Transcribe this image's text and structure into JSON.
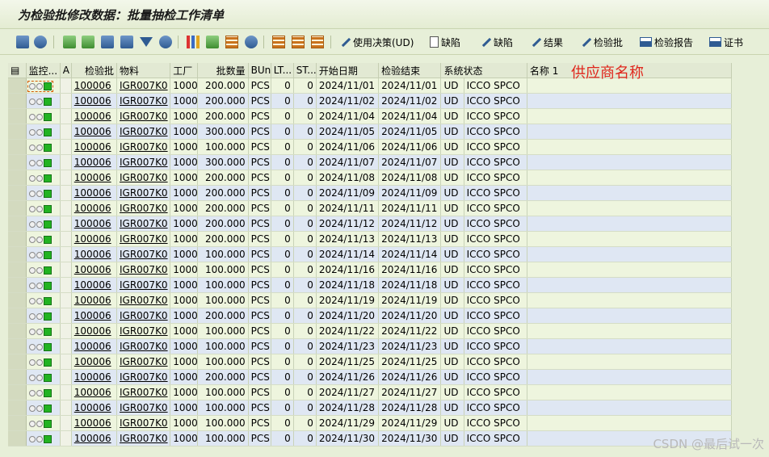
{
  "window": {
    "title": "为检验批修改数据：批量抽检工作清单"
  },
  "toolbar": {
    "use_decision_label": "使用决策(UD)",
    "defect_1_label": "缺陷",
    "defect_2_label": "缺陷",
    "result_label": "结果",
    "inspection_lot_label": "检验批",
    "inspection_report_label": "检验报告",
    "certificate_label": "证书"
  },
  "table": {
    "columns": [
      "监控...",
      "A",
      "检验批",
      "物料",
      "工厂",
      "批数量",
      "BUn",
      "LT...",
      "ST...",
      "开始日期",
      "检验结束",
      "系统状态",
      "",
      "名称 1"
    ],
    "rows": [
      [
        "100006",
        "IGR007K0",
        "1000",
        "200.000",
        "PCS",
        "0",
        "0",
        "2024/11/01",
        "2024/11/01",
        "UD",
        "ICCO SPCO"
      ],
      [
        "100006",
        "IGR007K0",
        "1000",
        "200.000",
        "PCS",
        "0",
        "0",
        "2024/11/02",
        "2024/11/02",
        "UD",
        "ICCO SPCO"
      ],
      [
        "100006",
        "IGR007K0",
        "1000",
        "200.000",
        "PCS",
        "0",
        "0",
        "2024/11/04",
        "2024/11/04",
        "UD",
        "ICCO SPCO"
      ],
      [
        "100006",
        "IGR007K0",
        "1000",
        "300.000",
        "PCS",
        "0",
        "0",
        "2024/11/05",
        "2024/11/05",
        "UD",
        "ICCO SPCO"
      ],
      [
        "100006",
        "IGR007K0",
        "1000",
        "100.000",
        "PCS",
        "0",
        "0",
        "2024/11/06",
        "2024/11/06",
        "UD",
        "ICCO SPCO"
      ],
      [
        "100006",
        "IGR007K0",
        "1000",
        "300.000",
        "PCS",
        "0",
        "0",
        "2024/11/07",
        "2024/11/07",
        "UD",
        "ICCO SPCO"
      ],
      [
        "100006",
        "IGR007K0",
        "1000",
        "200.000",
        "PCS",
        "0",
        "0",
        "2024/11/08",
        "2024/11/08",
        "UD",
        "ICCO SPCO"
      ],
      [
        "100006",
        "IGR007K0",
        "1000",
        "200.000",
        "PCS",
        "0",
        "0",
        "2024/11/09",
        "2024/11/09",
        "UD",
        "ICCO SPCO"
      ],
      [
        "100006",
        "IGR007K0",
        "1000",
        "200.000",
        "PCS",
        "0",
        "0",
        "2024/11/11",
        "2024/11/11",
        "UD",
        "ICCO SPCO"
      ],
      [
        "100006",
        "IGR007K0",
        "1000",
        "200.000",
        "PCS",
        "0",
        "0",
        "2024/11/12",
        "2024/11/12",
        "UD",
        "ICCO SPCO"
      ],
      [
        "100006",
        "IGR007K0",
        "1000",
        "200.000",
        "PCS",
        "0",
        "0",
        "2024/11/13",
        "2024/11/13",
        "UD",
        "ICCO SPCO"
      ],
      [
        "100006",
        "IGR007K0",
        "1000",
        "100.000",
        "PCS",
        "0",
        "0",
        "2024/11/14",
        "2024/11/14",
        "UD",
        "ICCO SPCO"
      ],
      [
        "100006",
        "IGR007K0",
        "1000",
        "100.000",
        "PCS",
        "0",
        "0",
        "2024/11/16",
        "2024/11/16",
        "UD",
        "ICCO SPCO"
      ],
      [
        "100006",
        "IGR007K0",
        "1000",
        "100.000",
        "PCS",
        "0",
        "0",
        "2024/11/18",
        "2024/11/18",
        "UD",
        "ICCO SPCO"
      ],
      [
        "100006",
        "IGR007K0",
        "1000",
        "100.000",
        "PCS",
        "0",
        "0",
        "2024/11/19",
        "2024/11/19",
        "UD",
        "ICCO SPCO"
      ],
      [
        "100006",
        "IGR007K0",
        "1000",
        "200.000",
        "PCS",
        "0",
        "0",
        "2024/11/20",
        "2024/11/20",
        "UD",
        "ICCO SPCO"
      ],
      [
        "100006",
        "IGR007K0",
        "1000",
        "100.000",
        "PCS",
        "0",
        "0",
        "2024/11/22",
        "2024/11/22",
        "UD",
        "ICCO SPCO"
      ],
      [
        "100006",
        "IGR007K0",
        "1000",
        "100.000",
        "PCS",
        "0",
        "0",
        "2024/11/23",
        "2024/11/23",
        "UD",
        "ICCO SPCO"
      ],
      [
        "100006",
        "IGR007K0",
        "1000",
        "100.000",
        "PCS",
        "0",
        "0",
        "2024/11/25",
        "2024/11/25",
        "UD",
        "ICCO SPCO"
      ],
      [
        "100006",
        "IGR007K0",
        "1000",
        "200.000",
        "PCS",
        "0",
        "0",
        "2024/11/26",
        "2024/11/26",
        "UD",
        "ICCO SPCO"
      ],
      [
        "100006",
        "IGR007K0",
        "1000",
        "100.000",
        "PCS",
        "0",
        "0",
        "2024/11/27",
        "2024/11/27",
        "UD",
        "ICCO SPCO"
      ],
      [
        "100006",
        "IGR007K0",
        "1000",
        "100.000",
        "PCS",
        "0",
        "0",
        "2024/11/28",
        "2024/11/28",
        "UD",
        "ICCO SPCO"
      ],
      [
        "100006",
        "IGR007K0",
        "1000",
        "100.000",
        "PCS",
        "0",
        "0",
        "2024/11/29",
        "2024/11/29",
        "UD",
        "ICCO SPCO"
      ],
      [
        "100006",
        "IGR007K0",
        "1000",
        "100.000",
        "PCS",
        "0",
        "0",
        "2024/11/30",
        "2024/11/30",
        "UD",
        "ICCO SPCO"
      ]
    ]
  },
  "annotation": {
    "vendor_name_label": "供应商名称"
  },
  "watermark": "CSDN @最后试一次",
  "colors": {
    "row_odd": "#eef5de",
    "row_even": "#dfe7f3",
    "annotation": "#e0261c",
    "status_lamp": "#22b322"
  },
  "icons": [
    "config-icon",
    "refresh-icon",
    "details-icon",
    "sort-ascending-icon",
    "filter-icon",
    "find-icon",
    "chart-icon",
    "export-icon",
    "layout-icon",
    "pencil-icon",
    "document-icon",
    "printer-icon"
  ]
}
